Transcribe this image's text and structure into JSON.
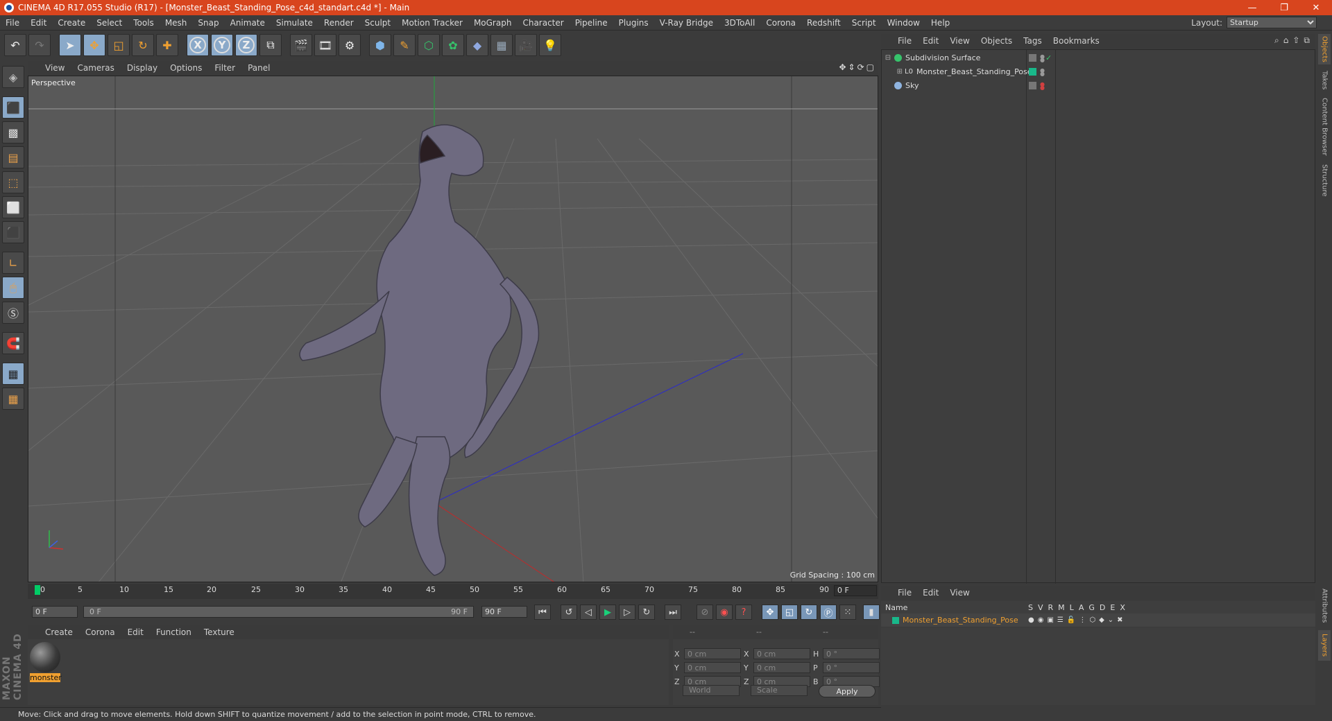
{
  "window": {
    "title": "CINEMA 4D R17.055 Studio (R17) - [Monster_Beast_Standing_Pose_c4d_standart.c4d *] - Main",
    "controls": [
      "—",
      "❐",
      "✕"
    ]
  },
  "menubar": {
    "items": [
      "File",
      "Edit",
      "Create",
      "Select",
      "Tools",
      "Mesh",
      "Snap",
      "Animate",
      "Simulate",
      "Render",
      "Sculpt",
      "Motion Tracker",
      "MoGraph",
      "Character",
      "Pipeline",
      "Plugins",
      "V-Ray Bridge",
      "3DToAll",
      "Corona",
      "Redshift",
      "Script",
      "Window",
      "Help"
    ],
    "layout_label": "Layout:",
    "layout_value": "Startup"
  },
  "toolbar": {
    "axis_x": "X",
    "axis_y": "Y",
    "axis_z": "Z"
  },
  "viewport": {
    "menu": [
      "View",
      "Cameras",
      "Display",
      "Options",
      "Filter",
      "Panel"
    ],
    "label": "Perspective",
    "grid_spacing": "Grid Spacing : 100 cm"
  },
  "timeline": {
    "ticks": [
      "0",
      "5",
      "10",
      "15",
      "20",
      "25",
      "30",
      "35",
      "40",
      "45",
      "50",
      "55",
      "60",
      "65",
      "70",
      "75",
      "80",
      "85",
      "90"
    ],
    "current_frame": "0 F"
  },
  "transport": {
    "start_field": "0 F",
    "range_start": "0 F",
    "range_end": "90 F",
    "end_field": "90 F"
  },
  "materials": {
    "menu": [
      "Create",
      "Corona",
      "Edit",
      "Function",
      "Texture"
    ],
    "items": [
      {
        "name": "monster"
      }
    ]
  },
  "coordinates": {
    "headers": [
      "--",
      "--",
      "--"
    ],
    "rows": [
      {
        "a": "X",
        "av": "0 cm",
        "b": "X",
        "bv": "0 cm",
        "c": "H",
        "cv": "0 °"
      },
      {
        "a": "Y",
        "av": "0 cm",
        "b": "Y",
        "bv": "0 cm",
        "c": "P",
        "cv": "0 °"
      },
      {
        "a": "Z",
        "av": "0 cm",
        "b": "Z",
        "bv": "0 cm",
        "c": "B",
        "cv": "0 °"
      }
    ],
    "mode1": "World",
    "mode2": "Scale",
    "apply": "Apply"
  },
  "status": {
    "text": "Move: Click and drag to move elements. Hold down SHIFT to quantize movement / add to the selection in point mode, CTRL to remove."
  },
  "objects": {
    "menu": [
      "File",
      "Edit",
      "View",
      "Objects",
      "Tags",
      "Bookmarks"
    ],
    "items": [
      {
        "name": "Subdivision Surface",
        "color": "#36c36b"
      },
      {
        "name": "Monster_Beast_Standing_Pose",
        "color": "#d0d0d0"
      },
      {
        "name": "Sky",
        "color": "#8fb4e0"
      }
    ]
  },
  "layers": {
    "menu": [
      "File",
      "Edit",
      "View"
    ],
    "header_name": "Name",
    "columns": [
      "S",
      "V",
      "R",
      "M",
      "L",
      "A",
      "G",
      "D",
      "E",
      "X"
    ],
    "rows": [
      {
        "name": "Monster_Beast_Standing_Pose",
        "color": "#19b88a"
      }
    ]
  },
  "right_tabs": [
    "Objects",
    "Takes",
    "Content Browser",
    "Structure",
    "Attributes",
    "Layers"
  ],
  "brand": "MAXON CINEMA 4D",
  "colors": {
    "accent": "#f0a030",
    "titlebar": "#d8451e",
    "selected_tool": "#8aa9c9"
  }
}
